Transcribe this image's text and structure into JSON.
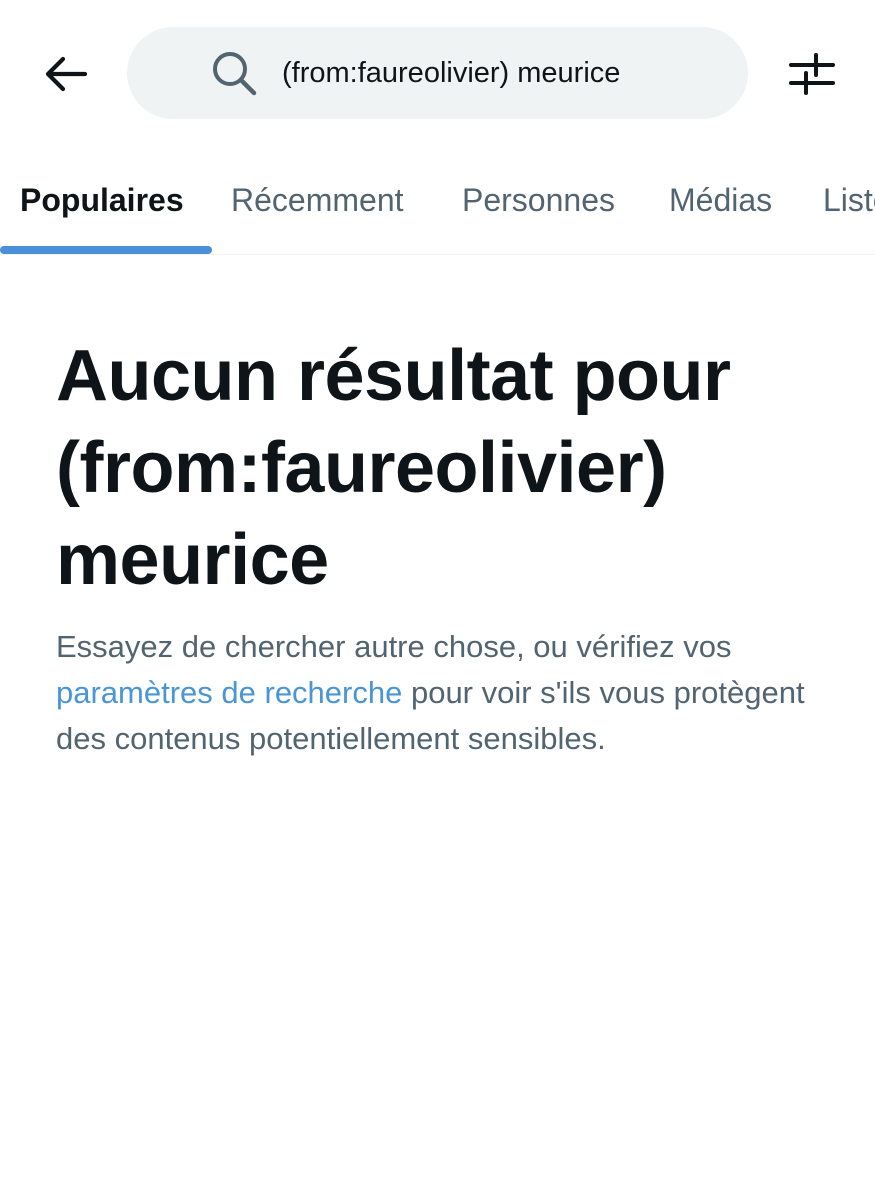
{
  "header": {
    "back_icon": "arrow-left-icon",
    "search": {
      "icon": "search-icon",
      "value": "(from:faureolivier) meurice"
    },
    "filter_icon": "sliders-icon"
  },
  "tabs": [
    {
      "label": "Populaires",
      "active": true
    },
    {
      "label": "Récemment",
      "active": false
    },
    {
      "label": "Personnes",
      "active": false
    },
    {
      "label": "Médias",
      "active": false
    },
    {
      "label": "Listes",
      "active": false
    }
  ],
  "colors": {
    "accent": "#4a8fd8",
    "link": "#4a95d4",
    "text_primary": "#0f1419",
    "text_secondary": "#536471",
    "search_bg": "#eff3f4"
  },
  "empty_state": {
    "title_line1": "Aucun résultat pour",
    "title_line2": "(from:faureolivier)",
    "title_line3": "meurice",
    "message_before": "Essayez de chercher autre chose, ou vérifiez vos ",
    "message_link": "paramètres de recherche",
    "message_after": " pour voir s'ils vous protègent des contenus potentiellement sensibles."
  }
}
